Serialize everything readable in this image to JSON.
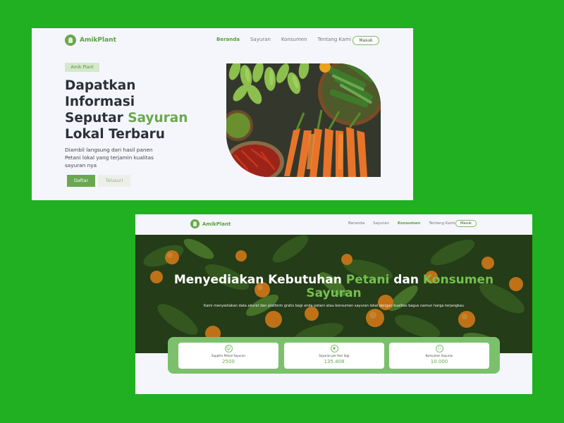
{
  "brand": {
    "name": "AmikPlant",
    "accent": "#6aa84f",
    "background": "#20b021"
  },
  "card1": {
    "nav": {
      "items": [
        {
          "label": "Beranda",
          "active": true
        },
        {
          "label": "Sayuran",
          "active": false
        },
        {
          "label": "Konsumen",
          "active": false
        },
        {
          "label": "Tentang Kami",
          "active": false
        }
      ],
      "login_label": "Masuk"
    },
    "hero": {
      "badge": "Amik Plant",
      "title_line1": "Dapatkan",
      "title_line2": "Informasi",
      "title_line3_a": "Seputar ",
      "title_line3_b": "Sayuran",
      "title_line4": "Lokal Terbaru",
      "description": "Diambil langsung dari hasil panen Petani lokal yang terjamin kualitas sayuran nya",
      "primary_button": "Daftar",
      "secondary_button": "Telusuri"
    }
  },
  "card2": {
    "nav": {
      "items": [
        {
          "label": "Beranda",
          "active": false
        },
        {
          "label": "Sayuran",
          "active": false
        },
        {
          "label": "Konsumen",
          "active": true
        },
        {
          "label": "Tentang Kami",
          "active": false
        }
      ],
      "login_label": "Masuk"
    },
    "hero": {
      "title_a": "Menyediakan Kebutuhan ",
      "title_b": "Petani",
      "title_c": " dan ",
      "title_d": "Konsumen",
      "title_e": "Sayuran",
      "description": "Kami menyediakan data akurat dan platform gratis bagi anda petani atau konsumen sayuran lokal dengan kualitas bagus namun harga terjangkau"
    },
    "stats": [
      {
        "icon": "farmer-icon",
        "glyph": "☺",
        "label": "Supplier Petani Sayuran",
        "value": "2500"
      },
      {
        "icon": "leaf-icon",
        "glyph": "❦",
        "label": "Sayuran per Hari (kg)",
        "value": "135.408"
      },
      {
        "icon": "people-icon",
        "glyph": "⚇",
        "label": "Konsumen Sayuran",
        "value": "10.000"
      }
    ]
  }
}
